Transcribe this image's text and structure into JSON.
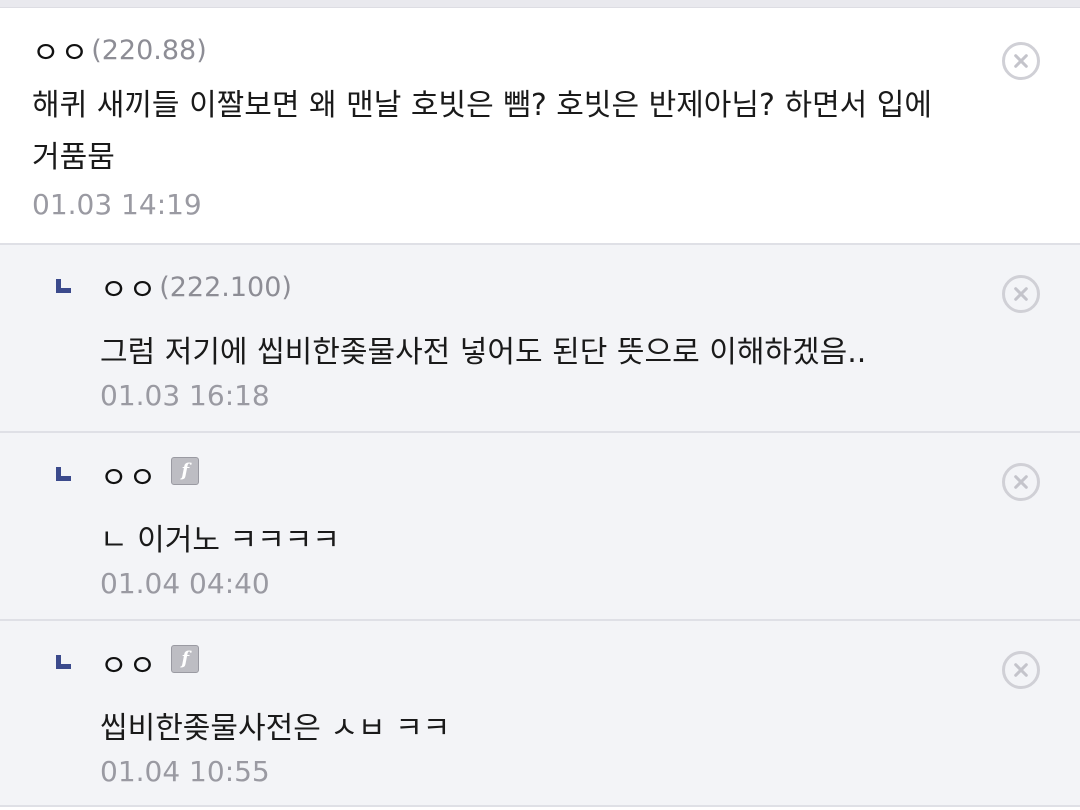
{
  "comments": [
    {
      "nickname": "ㅇㅇ",
      "ip": "(220.88)",
      "text": "해퀴 새끼들 이짤보면 왜 맨날 호빗은 뺌? 호빗은 반제아님? 하면서 입에 거품뭄",
      "date": "01.03 14:19"
    },
    {
      "nickname": "ㅇㅇ",
      "ip": "(222.100)",
      "text": "그럼 저기에 씹비한좆물사전 넣어도 된단 뜻으로 이해하겠음..",
      "date": "01.03 16:18"
    },
    {
      "nickname": "ㅇㅇ",
      "badge": "f",
      "text": "ㄴ 이거노 ㅋㅋㅋㅋ",
      "date": "01.04 04:40"
    },
    {
      "nickname": "ㅇㅇ",
      "badge": "f",
      "text": "씹비한좆물사전은 ㅅㅂ ㅋㅋ",
      "date": "01.04 10:55"
    }
  ],
  "icons": {
    "reply": "reply-arrow-icon",
    "delete": "delete-circle-x-icon",
    "fixed_nick": "fixed-nick-badge-icon"
  },
  "colors": {
    "reply_background": "#f3f4f7",
    "reply_arrow": "#3b4a8c",
    "muted_text": "#9a9aa2"
  }
}
